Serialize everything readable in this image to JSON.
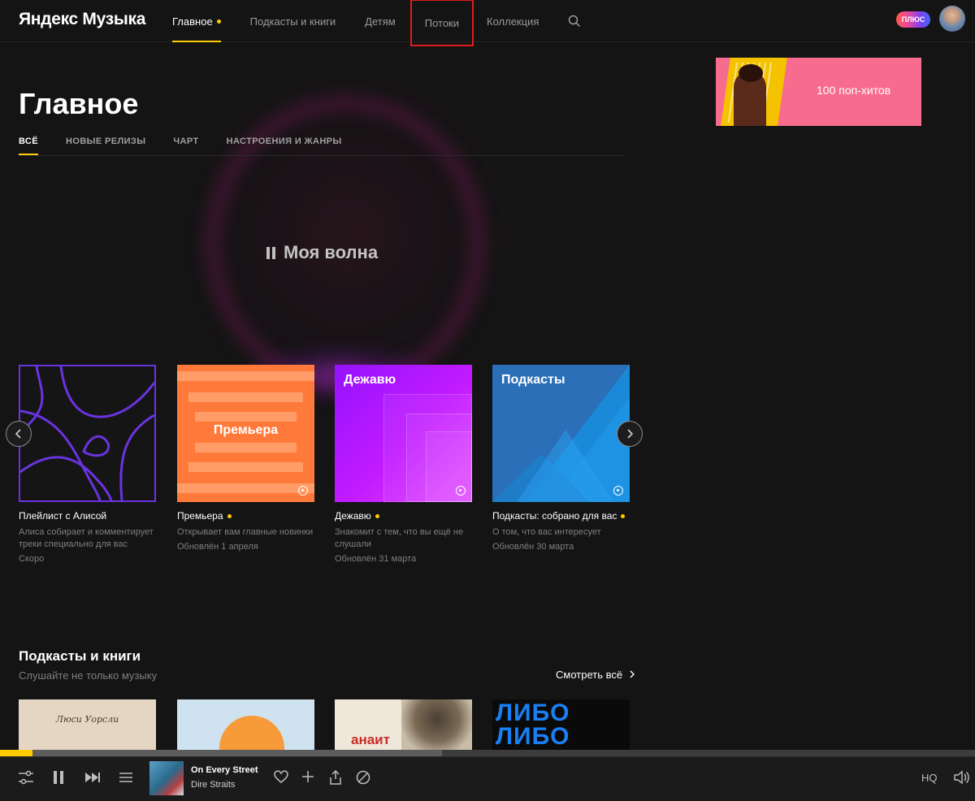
{
  "header": {
    "logo": "Яндекс Музыка",
    "nav": [
      {
        "label": "Главное",
        "active": true,
        "dot": true
      },
      {
        "label": "Подкасты и книги"
      },
      {
        "label": "Детям"
      },
      {
        "label": "Потоки",
        "highlighted": true
      },
      {
        "label": "Коллекция"
      }
    ],
    "plus_badge": "ПЛЮС"
  },
  "page": {
    "title": "Главное",
    "tabs": [
      "ВСЁ",
      "НОВЫЕ РЕЛИЗЫ",
      "ЧАРТ",
      "НАСТРОЕНИЯ И ЖАНРЫ"
    ],
    "active_tab": 0
  },
  "promo": {
    "text": "100 поп-хитов"
  },
  "wave": {
    "label": "Моя волна",
    "state": "playing"
  },
  "cards": [
    {
      "title": "Плейлист с Алисой",
      "desc": "Алиса собирает и комментирует треки специально для вас",
      "meta": "Скоро",
      "dot": false
    },
    {
      "cover_label": "Премьера",
      "title": "Премьера",
      "desc": "Открывает вам главные новинки",
      "meta": "Обновлён 1 апреля",
      "dot": true
    },
    {
      "cover_label": "Дежавю",
      "title": "Дежавю",
      "desc": "Знакомит с тем, что вы ещё не слушали",
      "meta": "Обновлён 31 марта",
      "dot": true
    },
    {
      "cover_label": "Подкасты",
      "title": "Подкасты: собрано для вас",
      "desc": "О том, что вас интересует",
      "meta": "Обновлён 30 марта",
      "dot": true
    }
  ],
  "section": {
    "title": "Подкасты и книги",
    "subtitle": "Слушайте не только музыку",
    "see_all": "Смотреть всё"
  },
  "books": [
    {
      "cover_text": "Люси Уорсли"
    },
    {
      "cover_text": ""
    },
    {
      "cover_text": "анаит"
    },
    {
      "cover_text": "ЛИБО ЛИБО"
    }
  ],
  "player": {
    "track_title": "On Every Street",
    "artist": "Dire Straits",
    "quality": "HQ",
    "progress": 0.033,
    "buffered": 0.453
  },
  "colors": {
    "accent": "#ffcc00",
    "background": "#141414"
  }
}
